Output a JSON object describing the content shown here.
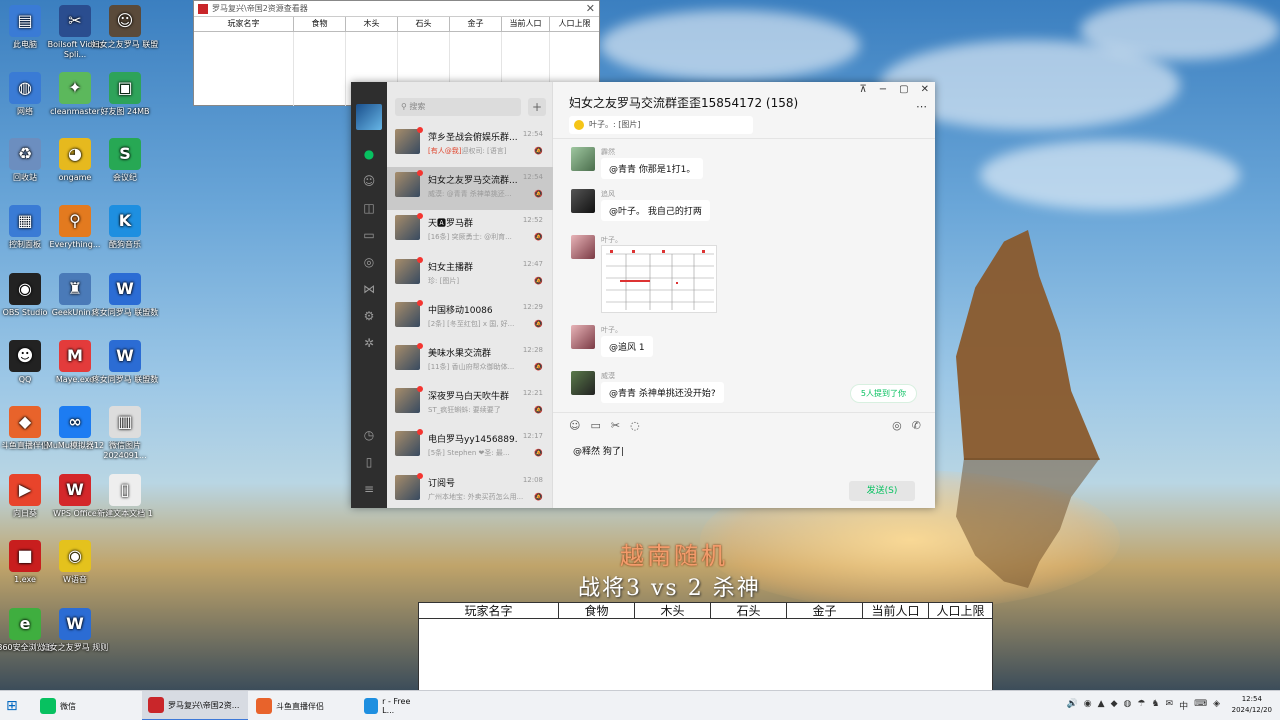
{
  "desktop": {
    "icons": [
      {
        "label": "此电脑",
        "symbol": "▤",
        "color": "#3a7bd5"
      },
      {
        "label": "Boilsoft Video Spli...",
        "symbol": "✂",
        "color": "#2a4d8f"
      },
      {
        "label": "妇女之友罗马 联盟",
        "symbol": "☺",
        "color": "#5a4a3a"
      },
      {
        "label": "网络",
        "symbol": "◍",
        "color": "#3a7bd5"
      },
      {
        "label": "cleanmaster",
        "symbol": "✦",
        "color": "#5cb85c"
      },
      {
        "label": "好友图 24MB",
        "symbol": "▣",
        "color": "#2ea35a"
      },
      {
        "label": "回收站",
        "symbol": "♻",
        "color": "#6c8ebf"
      },
      {
        "label": "ongame",
        "symbol": "◕",
        "color": "#e6b91e"
      },
      {
        "label": "会议纪",
        "symbol": "S",
        "color": "#27a854"
      },
      {
        "label": "控制面板",
        "symbol": "▦",
        "color": "#3a7bd5"
      },
      {
        "label": "Everything...",
        "symbol": "⚲",
        "color": "#e37a1f"
      },
      {
        "label": "酷狗音乐",
        "symbol": "K",
        "color": "#1e8fe0"
      },
      {
        "label": "OBS Studio",
        "symbol": "◉",
        "color": "#222"
      },
      {
        "label": "GeekUnin...",
        "symbol": "♜",
        "color": "#4a7ab8"
      },
      {
        "label": "疼女同罗马 联盟数",
        "symbol": "W",
        "color": "#2b6cd4"
      },
      {
        "label": "QQ",
        "symbol": "☻",
        "color": "#222"
      },
      {
        "label": "Maye.exe",
        "symbol": "M",
        "color": "#e33b3b"
      },
      {
        "label": "疼女同罗马 联盟数",
        "symbol": "W",
        "color": "#2b6cd4"
      },
      {
        "label": "斗鱼直播伴侣",
        "symbol": "◆",
        "color": "#e8632b"
      },
      {
        "label": "MuMu模拟器12",
        "symbol": "∞",
        "color": "#1d7cf2"
      },
      {
        "label": "微信图片 2024091...",
        "symbol": "▥",
        "color": "#ddd"
      },
      {
        "label": "向日葵",
        "symbol": "▶",
        "color": "#e8442b"
      },
      {
        "label": "WPS Office",
        "symbol": "W",
        "color": "#d4272a"
      },
      {
        "label": "新建文本文档 1",
        "symbol": "▯",
        "color": "#eee"
      },
      {
        "label": "1.exe",
        "symbol": "■",
        "color": "#c81e1e"
      },
      {
        "label": "W语音",
        "symbol": "◉",
        "color": "#e4c21d"
      },
      {
        "label": "360安全浏览器",
        "symbol": "e",
        "color": "#3fae3f"
      },
      {
        "label": "妇女之友罗马 规则",
        "symbol": "W",
        "color": "#2b6cd4"
      }
    ]
  },
  "small_window": {
    "title": "罗马复兴\\帝国2资源查看器",
    "close": "✕",
    "columns": [
      "玩家名字",
      "食物",
      "木头",
      "石头",
      "金子",
      "当前人口",
      "人口上限"
    ]
  },
  "overlay": {
    "line1": "越南随机",
    "line2": "战将3 vs 2 杀神"
  },
  "big_table": {
    "columns": [
      "玩家名字",
      "食物",
      "木头",
      "石头",
      "金子",
      "当前人口",
      "人口上限"
    ]
  },
  "wechat": {
    "search_placeholder": "搜索",
    "add": "+",
    "rail_icons": [
      "chat-icon",
      "contacts-icon",
      "favorites-icon",
      "files-icon",
      "moments-icon",
      "channels-icon",
      "search-icon",
      "miniprogram-icon",
      "phone-icon",
      "mobile-icon",
      "menu-icon"
    ],
    "chats": [
      {
        "name": "萍乡圣战会俯娱乐群...",
        "time": "12:54",
        "preview_tag": "[有人@我]",
        "preview": "迎权司: [语言]"
      },
      {
        "name": "妇女之友罗马交流群...",
        "time": "12:54",
        "preview_tag": "",
        "preview": "威漠: @青青 杀神单挑还..."
      },
      {
        "name": "天🅰罗马群",
        "time": "12:52",
        "preview_tag": "",
        "preview": "[16条] 突厥勇士: @利育..."
      },
      {
        "name": "妇女主播群",
        "time": "12:47",
        "preview_tag": "",
        "preview": "珍: [图片]"
      },
      {
        "name": "中国移动10086",
        "time": "12:29",
        "preview_tag": "",
        "preview": "[2条] [冬至红包] x 国, 好..."
      },
      {
        "name": "美味水果交流群",
        "time": "12:28",
        "preview_tag": "",
        "preview": "[11条] 香山府帮众御助体..."
      },
      {
        "name": "深夜罗马白天吹牛群",
        "time": "12:21",
        "preview_tag": "",
        "preview": "ST_疯狂蝌蚪: 要续要了"
      },
      {
        "name": "电白罗马yy1456889...",
        "time": "12:17",
        "preview_tag": "",
        "preview": "[5条] Stephen ❤圣: 最..."
      },
      {
        "name": "订阅号",
        "time": "12:08",
        "preview_tag": "",
        "preview": "广州本地宝: 外卖买药怎么用..."
      }
    ],
    "title": "妇女之友罗马交流群歪歪15854172 (158)",
    "window_controls": [
      "⊼",
      "−",
      "▢",
      "✕"
    ],
    "more": "⋯",
    "pinned": "叶子。: [图片]",
    "messages": [
      {
        "name": "霹然",
        "text": "@青青 你那是1打1。"
      },
      {
        "name": "追风",
        "text": "@叶子。 我自己的打两"
      },
      {
        "name": "叶子。",
        "text": ""
      },
      {
        "name": "叶子。",
        "text": "@追风 1"
      },
      {
        "name": "威漠",
        "text": "@青青 杀神单挑还没开始?"
      }
    ],
    "notice": "5人提到了你",
    "tools_left": [
      "☺",
      "▭",
      "✂",
      "◌"
    ],
    "tools_right": [
      "◎",
      "✆"
    ],
    "input_text": "@释然 狗了",
    "send": "发送(S)"
  },
  "taskbar": {
    "start": "⊞",
    "items": [
      {
        "label": "微信",
        "color": "#07c160",
        "active": false
      },
      {
        "label": "罗马复兴\\帝国2资...",
        "color": "#c9262a",
        "active": true
      },
      {
        "label": "斗鱼直播伴侣",
        "color": "#e8632b",
        "active": false
      },
      {
        "label": "r - Free L...",
        "color": "#1e8fe0",
        "active": false
      }
    ],
    "tray_icons": [
      "🔊",
      "◉",
      "▲",
      "◆",
      "◍",
      "☂",
      "♞",
      "✉",
      "中",
      "⌨",
      "◈"
    ],
    "time": "12:54",
    "date": "2024/12/20"
  }
}
